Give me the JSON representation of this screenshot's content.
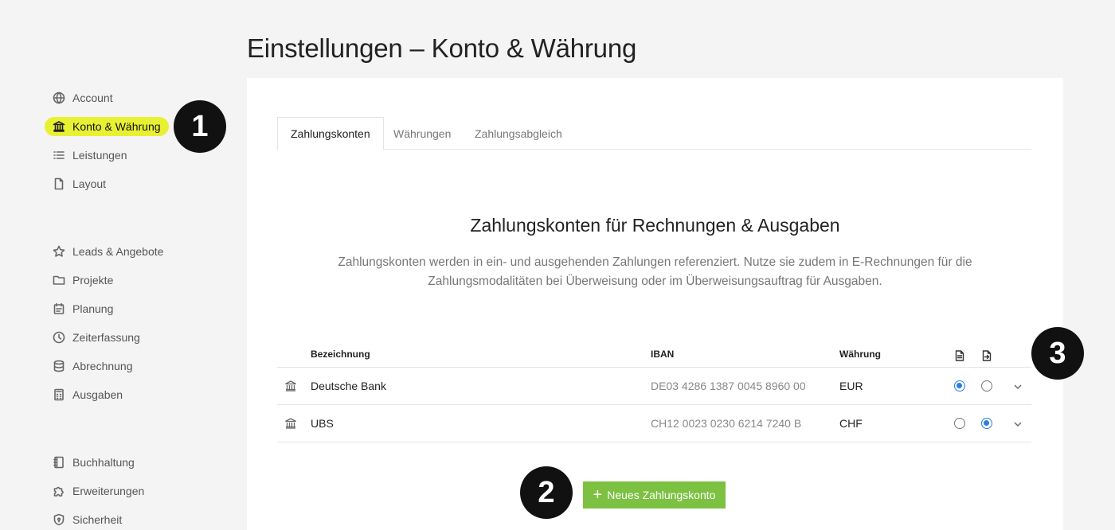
{
  "page": {
    "title": "Einstellungen – Konto & Währung"
  },
  "sidebar": {
    "items": [
      {
        "label": "Account",
        "icon": "globe-icon"
      },
      {
        "label": "Konto & Währung",
        "icon": "bank-icon",
        "active": true
      },
      {
        "label": "Leistungen",
        "icon": "list-icon"
      },
      {
        "label": "Layout",
        "icon": "document-icon"
      },
      {
        "label": "Leads & Angebote",
        "icon": "star-icon"
      },
      {
        "label": "Projekte",
        "icon": "folder-icon"
      },
      {
        "label": "Planung",
        "icon": "calendar-icon"
      },
      {
        "label": "Zeiterfassung",
        "icon": "clock-icon"
      },
      {
        "label": "Abrechnung",
        "icon": "database-icon"
      },
      {
        "label": "Ausgaben",
        "icon": "calculator-icon"
      },
      {
        "label": "Buchhaltung",
        "icon": "ledger-icon"
      },
      {
        "label": "Erweiterungen",
        "icon": "puzzle-icon"
      },
      {
        "label": "Sicherheit",
        "icon": "shield-icon"
      }
    ],
    "active_color": "#e8f032"
  },
  "markers": [
    "1",
    "2",
    "3"
  ],
  "tabs": [
    {
      "label": "Zahlungskonten",
      "active": true
    },
    {
      "label": "Währungen"
    },
    {
      "label": "Zahlungsabgleich"
    }
  ],
  "section": {
    "title": "Zahlungskonten für Rechnungen & Ausgaben",
    "description": "Zahlungskonten werden in ein- und ausgehenden Zahlungen referenziert. Nutze sie zudem in E-Rechnungen für die Zahlungsmodalitäten bei Überweisung oder im Überweisungsauftrag für Ausgaben."
  },
  "table": {
    "columns": {
      "name": "Bezeichnung",
      "iban": "IBAN",
      "currency": "Währung",
      "invoice_icon": "invoice-document-icon",
      "expense_icon": "expense-document-icon"
    },
    "rows": [
      {
        "name": "Deutsche Bank",
        "iban": "DE03 4286 1387 0045 8960 00",
        "currency": "EUR",
        "default_invoice": true,
        "default_expense": false
      },
      {
        "name": "UBS",
        "iban": "CH12 0023 0230 6214 7240 B",
        "currency": "CHF",
        "default_invoice": false,
        "default_expense": true
      }
    ]
  },
  "add_button": {
    "label": "Neues Zahlungskonto",
    "color": "#7cc142"
  },
  "accent_color": "#2a7ee6"
}
